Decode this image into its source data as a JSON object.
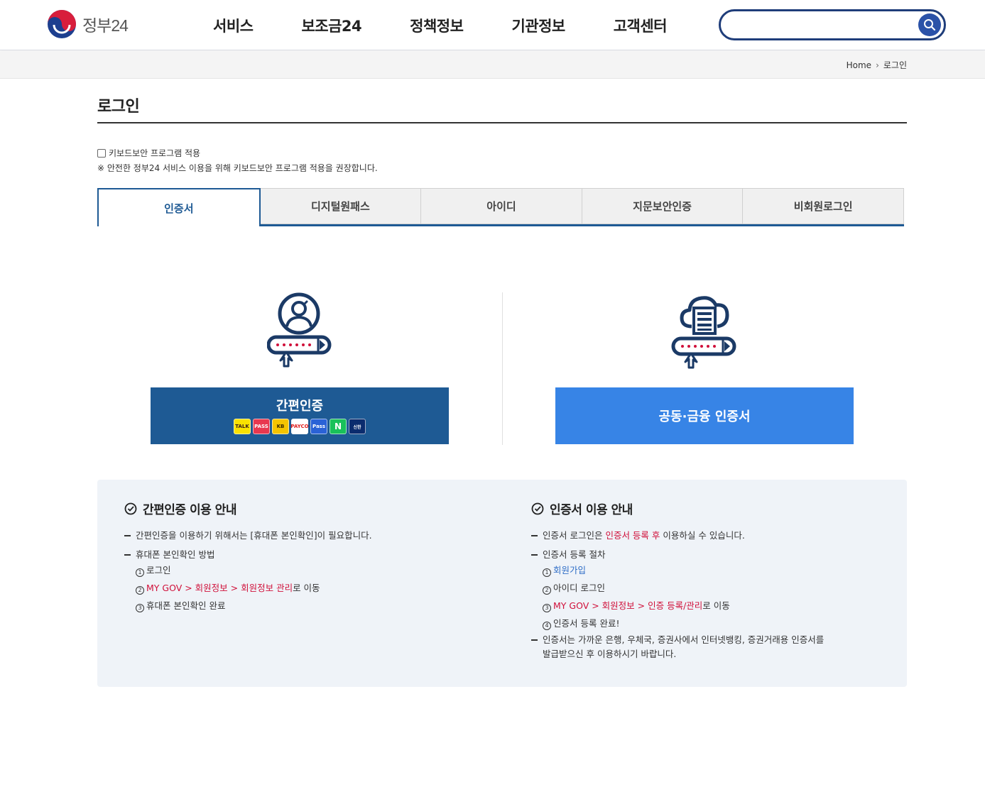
{
  "header": {
    "logo_text": "정부24",
    "nav": [
      "서비스",
      "보조금24",
      "정책정보",
      "기관정보",
      "고객센터"
    ],
    "search_placeholder": ""
  },
  "breadcrumb": {
    "home": "Home",
    "current": "로그인"
  },
  "page": {
    "title": "로그인",
    "keyboard_security_label": "키보드보안 프로그램 적용",
    "keyboard_security_note": "※ 안전한 정부24 서비스 이용을 위해 키보드보안 프로그램 적용을 권장합니다."
  },
  "tabs": [
    "인증서",
    "디지털원패스",
    "아이디",
    "지문보안인증",
    "비회원로그인"
  ],
  "login_options": {
    "simple_auth_label": "간편인증",
    "cert_label": "공동·금융 인증서",
    "badges": [
      "TALK",
      "PASS",
      "KB",
      "PAYCO",
      "Pass",
      "N",
      "신한"
    ]
  },
  "guide_left": {
    "title": "간편인증 이용 안내",
    "item1": "간편인증을 이용하기 위해서는 [휴대폰 본인확인]이 필요합니다.",
    "item2": "휴대폰 본인확인 방법",
    "step1_num": "1",
    "step1": "로그인",
    "step2_num": "2",
    "step2_link": "MY GOV > 회원정보 > 회원정보 관리",
    "step2_suffix": "로 이동",
    "step3_num": "3",
    "step3": "휴대폰 본인확인 완료"
  },
  "guide_right": {
    "title": "인증서 이용 안내",
    "item1_prefix": "인증서 로그인은 ",
    "item1_highlight": "인증서 등록 후",
    "item1_suffix": " 이용하실 수 있습니다.",
    "item2": "인증서 등록 절차",
    "step1_num": "1",
    "step1_link": "회원가입",
    "step2_num": "2",
    "step2": "아이디 로그인",
    "step3_num": "3",
    "step3_link": "MY GOV > 회원정보 > 인증 등록/관리",
    "step3_suffix": "로 이동",
    "step4_num": "4",
    "step4": "인증서 등록 완료!",
    "item3_line1": "인증서는 가까운 은행, 우체국, 증권사에서 인터넷뱅킹, 증권거래용 인증서를",
    "item3_line2": "발급받으신 후 이용하시기 바랍니다."
  },
  "colors": {
    "primary": "#1e5a94",
    "cert_button": "#3784e6",
    "link_red": "#d0103a",
    "link_blue": "#2f6ec7",
    "guide_bg": "#eff3f8"
  }
}
